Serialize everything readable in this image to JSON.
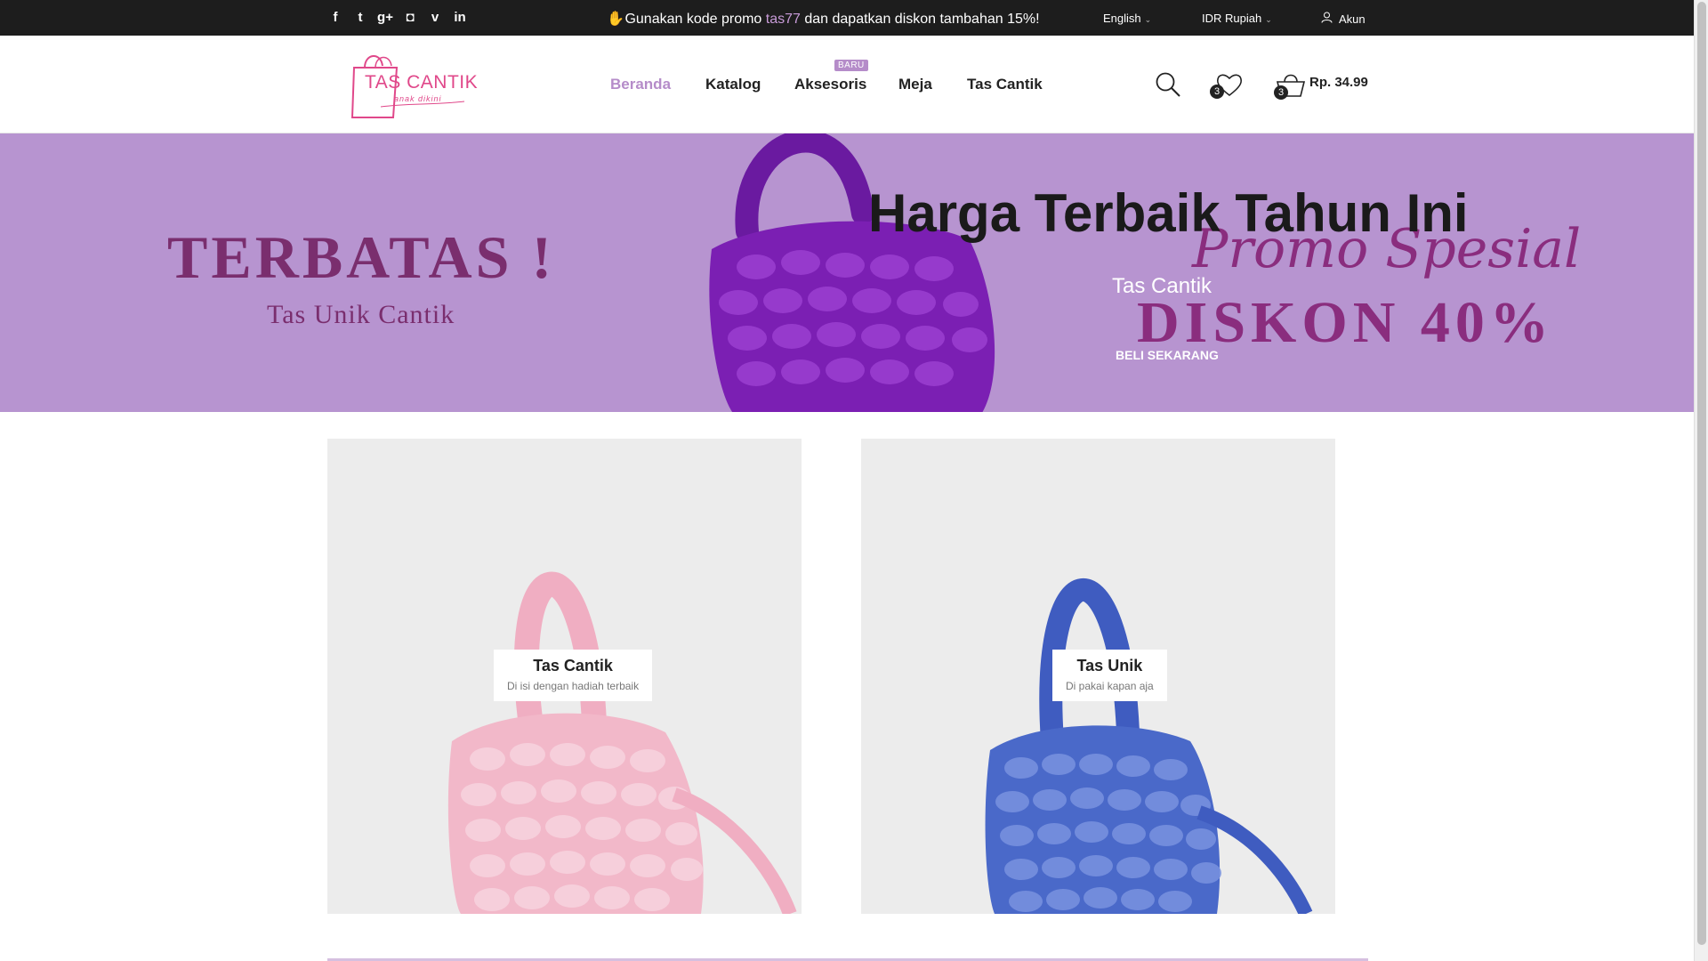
{
  "topbar": {
    "social": [
      {
        "name": "facebook-icon",
        "glyph": "f"
      },
      {
        "name": "twitter-icon",
        "glyph": "t"
      },
      {
        "name": "google-plus-icon",
        "glyph": "g+"
      },
      {
        "name": "instagram-icon",
        "glyph": "◘"
      },
      {
        "name": "vimeo-icon",
        "glyph": "v"
      },
      {
        "name": "linkedin-icon",
        "glyph": "in"
      }
    ],
    "promo_prefix": "Gunakan kode promo ",
    "promo_code": "tas77",
    "promo_suffix": " dan dapatkan diskon tambahan 15%!",
    "language": "English",
    "currency": "IDR Rupiah",
    "account": "Akun"
  },
  "header": {
    "logo_text": "TAS CANTIK",
    "logo_sub": "anak dikini",
    "nav": {
      "home": "Beranda",
      "catalog": "Katalog",
      "accessories": "Aksesoris",
      "table": "Meja",
      "tas_cantik": "Tas Cantik"
    },
    "new_badge": "BARU",
    "wishlist_count": "3",
    "cart_count": "3",
    "cart_total": "Rp. 34.99"
  },
  "banner": {
    "left_title": "TERBATAS !",
    "left_sub": "Tas Unik Cantik",
    "promo_script": "Promo Spesial",
    "promo_big": "DISKON 40%",
    "heading": "Harga Terbaik Tahun Ini",
    "subheading": "Tas Cantik",
    "cta": "BELI SEKARANG"
  },
  "cards": [
    {
      "title": "Tas Cantik",
      "subtitle": "Di isi dengan hadiah terbaik"
    },
    {
      "title": "Tas Unik",
      "subtitle": "Di pakai kapan aja"
    }
  ],
  "colors": {
    "accent": "#b58cc9",
    "banner_bg": "#b794d0",
    "topbar_bg": "#1d1d1d",
    "brand_pink": "#e0488a",
    "bag_purple": "#7b1fb3",
    "bag_pink": "#f2b8c9",
    "bag_blue": "#4a69c9"
  }
}
